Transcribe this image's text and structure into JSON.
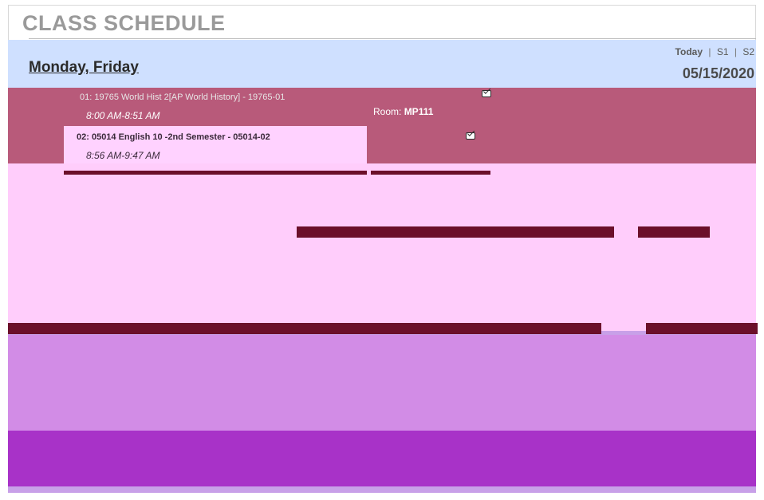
{
  "header": {
    "title": "CLASS SCHEDULE",
    "days": "Monday, Friday",
    "semester_links": {
      "today": "Today",
      "s1": "S1",
      "s2": "S2",
      "separator": "|"
    },
    "date": "05/15/2020"
  },
  "schedule": {
    "rows": [
      {
        "line": "01: 19765 World Hist 2[AP World History] - 19765-01",
        "time": "8:00 AM-8:51 AM"
      },
      {
        "line": "02: 05014 English 10 -2nd Semester - 05014-02",
        "time": "8:56 AM-9:47 AM"
      }
    ],
    "room": {
      "label": "Room:",
      "value": "MP111"
    }
  },
  "colors": {
    "accent_rows": "#b85a7a",
    "header_band": "#cfe0ff",
    "pink_band": "#ffcdfb",
    "purple_band": "#d28ce6",
    "dark_band": "#a832c8"
  }
}
